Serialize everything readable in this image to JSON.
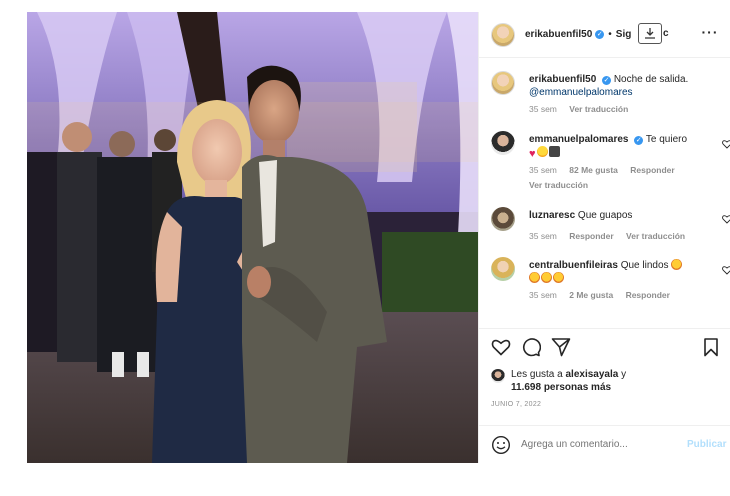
{
  "post": {
    "author": "erikabuenfil50",
    "follow_label": "Sig",
    "follow_suffix": "c",
    "caption": "Noche de salida.",
    "caption_mention": "@emmanuelpalomares",
    "caption_time": "35 sem",
    "caption_translate": "Ver traducción",
    "date": "JUNIO 7, 2022"
  },
  "comments": [
    {
      "user": "emmanuelpalomares",
      "verified": true,
      "text": "Te quiero",
      "time": "35 sem",
      "likes": "82 Me gusta",
      "reply": "Responder",
      "translate": "Ver traducción"
    },
    {
      "user": "luznaresc",
      "text": "Que guapos",
      "time": "35 sem",
      "reply": "Responder",
      "translate": "Ver traducción"
    },
    {
      "user": "centralbuenfileiras",
      "text": "Que lindos",
      "time": "35 sem",
      "likes": "2 Me gusta",
      "reply": "Responder"
    }
  ],
  "likes": {
    "prefix": "Les gusta a",
    "user": "alexisayala",
    "conj": "y",
    "count": "11.698 personas más"
  },
  "add_comment": {
    "placeholder": "Agrega un comentario...",
    "publish": "Publicar"
  },
  "icons": {
    "like": "heart-icon",
    "comment": "comment-icon",
    "share": "send-icon",
    "save": "bookmark-icon",
    "emoji": "smiley-icon",
    "download": "download-icon",
    "more": "more-dots-icon"
  },
  "colors": {
    "link": "#00376b",
    "verified": "#3897f0",
    "muted": "#8e8e8e",
    "publish": "#b2dffc"
  }
}
